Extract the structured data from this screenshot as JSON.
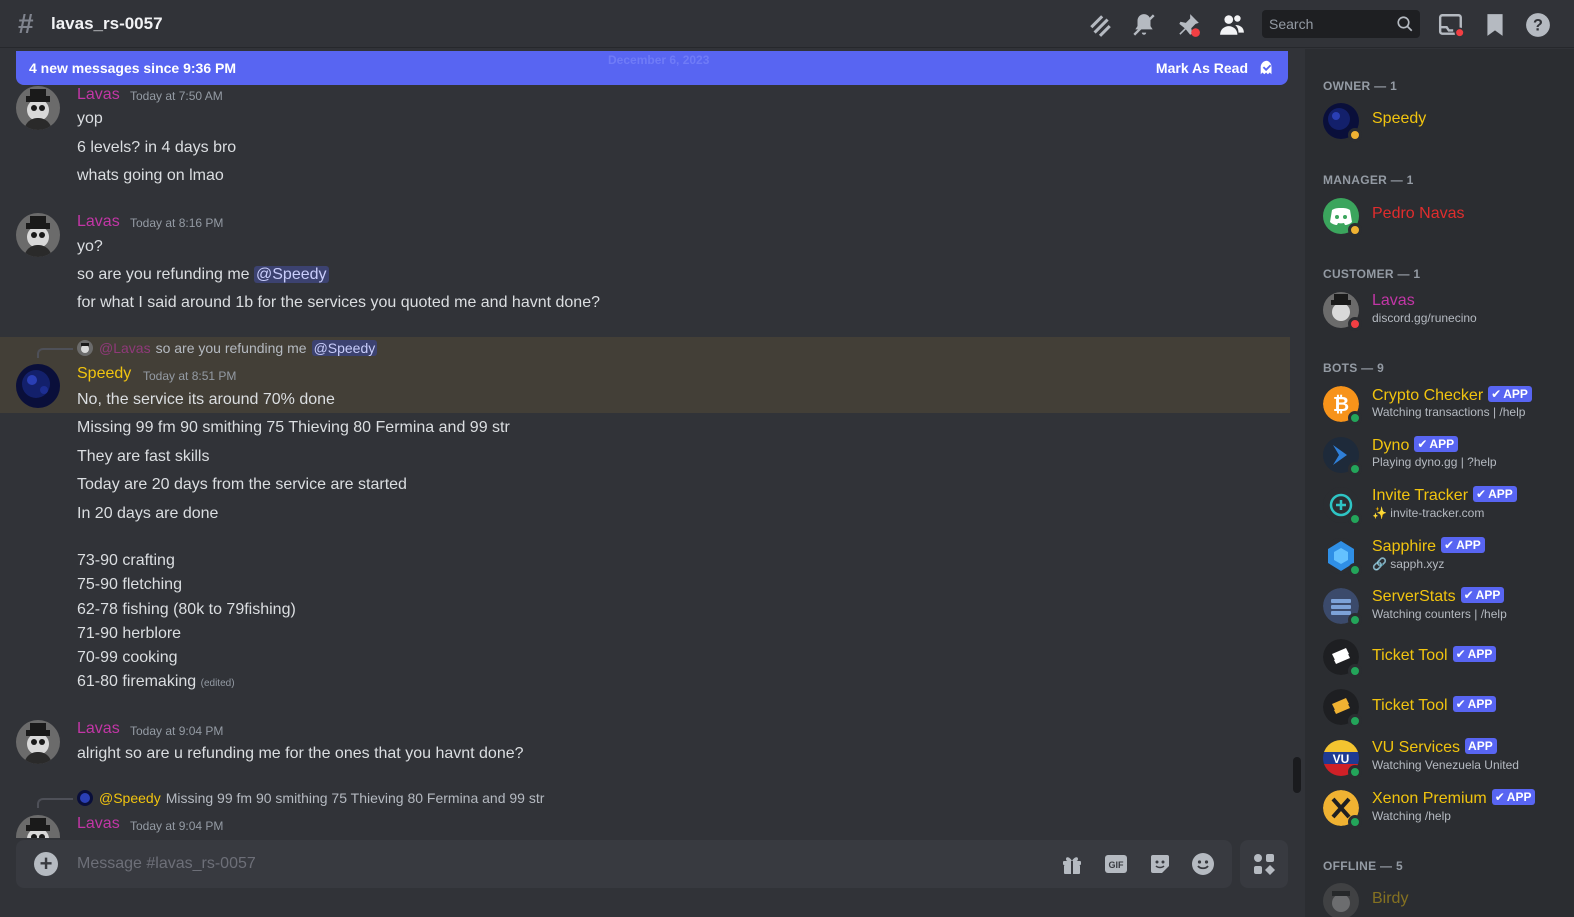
{
  "header": {
    "channel_name": "lavas_rs-0057",
    "search_placeholder": "Search",
    "icons": [
      "threads-icon",
      "mute-icon",
      "pin-icon",
      "members-icon",
      "inbox-icon",
      "bookmark-icon",
      "help-icon"
    ]
  },
  "new_messages_bar": {
    "text": "4 new messages since 9:36 PM",
    "date_divider": "December 6, 2023",
    "mark_read_label": "Mark As Read"
  },
  "colors": {
    "lavas": "#c236a6",
    "speedy": "#f1c40f",
    "pedro": "#e02d2d",
    "accent": "#5865f2"
  },
  "messages": [
    {
      "author": "Lavas",
      "timestamp": "Today at 7:50 AM",
      "lines": [
        "yop",
        "6 levels? in 4 days bro",
        "whats going on lmao"
      ]
    },
    {
      "author": "Lavas",
      "timestamp": "Today at 8:16 PM",
      "lines": [
        "yo?",
        "so are you refunding me",
        "for what I said around 1b for the services you quoted me and havnt done?"
      ],
      "mention": "@Speedy"
    },
    {
      "reply_author": "@Lavas",
      "reply_text": "so are you refunding me",
      "reply_mention": "@Speedy",
      "author": "Speedy",
      "timestamp": "Today at 8:51 PM",
      "lines": [
        "No, the service its around 70% done",
        "Missing 99 fm 90 smithing 75 Thieving 80 Fermina and 99 str",
        "They are fast skills",
        "Today are 20 days from the service are started",
        "In 20 days are done",
        "73-90 crafting",
        "75-90 fletching",
        "62-78 fishing (80k to 79fishing)",
        "71-90 herblore",
        "70-99 cooking",
        "61-80 firemaking"
      ],
      "edited": "(edited)"
    },
    {
      "author": "Lavas",
      "timestamp": "Today at 9:04 PM",
      "lines": [
        "alright so are u refunding me for the ones that you havnt done?"
      ]
    },
    {
      "reply_author": "@Speedy",
      "reply_text": "Missing 99 fm 90 smithing 75 Thieving 80 Fermina and 99 str",
      "author": "Lavas",
      "timestamp": "Today at 9:04 PM"
    }
  ],
  "composer": {
    "placeholder": "Message #lavas_rs-0057",
    "gif_label": "GIF"
  },
  "members": {
    "groups": [
      {
        "label": "OWNER — 1"
      },
      {
        "label": "MANAGER — 1"
      },
      {
        "label": "CUSTOMER — 1"
      },
      {
        "label": "BOTS — 9"
      },
      {
        "label": "OFFLINE — 5"
      }
    ],
    "app_badge": "APP",
    "list": [
      {
        "name": "Speedy",
        "color": "#f1c40f",
        "status": "idle"
      },
      {
        "name": "Pedro Navas",
        "color": "#e02d2d",
        "status": "idle"
      },
      {
        "name": "Lavas",
        "color": "#c236a6",
        "sub": "discord.gg/runecino",
        "status": "dnd"
      },
      {
        "name": "Crypto Checker",
        "color": "#f1c40f",
        "sub": "Watching transactions | /help",
        "verified": true
      },
      {
        "name": "Dyno",
        "color": "#f1c40f",
        "sub": "Playing dyno.gg | ?help",
        "verified": true
      },
      {
        "name": "Invite Tracker",
        "color": "#f1c40f",
        "sub": "invite-tracker.com",
        "verified": true
      },
      {
        "name": "Sapphire",
        "color": "#f1c40f",
        "sub": "sapph.xyz",
        "verified": true
      },
      {
        "name": "ServerStats",
        "color": "#f1c40f",
        "sub": "Watching counters | /help",
        "verified": true
      },
      {
        "name": "Ticket Tool",
        "color": "#f1c40f",
        "verified": true
      },
      {
        "name": "Ticket Tool",
        "color": "#f1c40f",
        "verified": true
      },
      {
        "name": "VU Services",
        "color": "#f1c40f",
        "sub": "Watching Venezuela United",
        "verified": false
      },
      {
        "name": "Xenon Premium",
        "color": "#f1c40f",
        "sub": "Watching /help",
        "verified": true
      },
      {
        "name": "Birdy",
        "color": "#8a7a3a"
      }
    ]
  }
}
